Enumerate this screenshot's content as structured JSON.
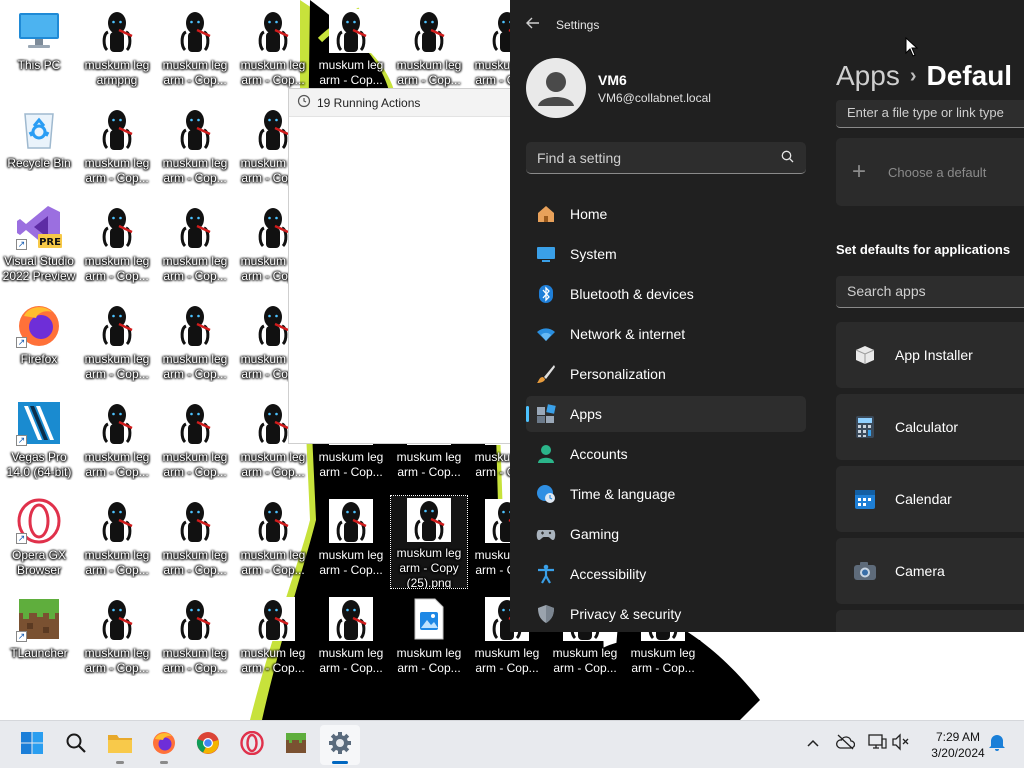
{
  "desktop": {
    "system_icons": [
      {
        "label": "This PC",
        "icon": "this-pc-icon"
      },
      {
        "label": "Recycle Bin",
        "icon": "recycle-bin-icon"
      },
      {
        "label": "Visual Studio 2022 Preview",
        "icon": "visual-studio-icon"
      },
      {
        "label": "Firefox",
        "icon": "firefox-icon"
      },
      {
        "label": "Vegas Pro 14.0 (64-bit)",
        "icon": "vegas-pro-icon"
      },
      {
        "label": "Opera GX Browser",
        "icon": "opera-gx-icon"
      },
      {
        "label": "TLauncher",
        "icon": "tlauncher-icon"
      }
    ],
    "file_labels": {
      "first": "muskum leg armpng",
      "copy": "muskum leg arm - Cop...",
      "selected": "muskum leg arm - Copy (25).png"
    }
  },
  "running_window": {
    "title": "19 Running Actions"
  },
  "settings": {
    "app_title": "Settings",
    "user": {
      "name": "VM6",
      "email": "VM6@collabnet.local"
    },
    "search_placeholder": "Find a setting",
    "nav": [
      {
        "label": "Home",
        "icon": "home-icon"
      },
      {
        "label": "System",
        "icon": "system-icon"
      },
      {
        "label": "Bluetooth & devices",
        "icon": "bluetooth-icon"
      },
      {
        "label": "Network & internet",
        "icon": "wifi-icon"
      },
      {
        "label": "Personalization",
        "icon": "brush-icon"
      },
      {
        "label": "Apps",
        "icon": "apps-icon",
        "active": true
      },
      {
        "label": "Accounts",
        "icon": "accounts-icon"
      },
      {
        "label": "Time & language",
        "icon": "globe-clock-icon"
      },
      {
        "label": "Gaming",
        "icon": "gamepad-icon"
      },
      {
        "label": "Accessibility",
        "icon": "accessibility-icon"
      },
      {
        "label": "Privacy & security",
        "icon": "shield-icon"
      }
    ],
    "content": {
      "breadcrumb_parent": "Apps",
      "breadcrumb_separator": "›",
      "breadcrumb_current": "Defaul",
      "filetype_placeholder": "Enter a file type or link type",
      "choose_default": "Choose a default",
      "section_title": "Set defaults for applications",
      "apps_search_placeholder": "Search apps",
      "apps": [
        {
          "label": "App Installer",
          "icon": "app-installer-icon"
        },
        {
          "label": "Calculator",
          "icon": "calculator-icon"
        },
        {
          "label": "Calendar",
          "icon": "calendar-icon"
        },
        {
          "label": "Camera",
          "icon": "camera-icon"
        }
      ]
    }
  },
  "taskbar": {
    "pinned": [
      {
        "name": "start-button",
        "icon": "windows-logo-icon"
      },
      {
        "name": "search-button",
        "icon": "search-icon"
      },
      {
        "name": "file-explorer-button",
        "icon": "folder-icon"
      },
      {
        "name": "firefox-taskbar-button",
        "icon": "firefox-icon"
      },
      {
        "name": "chrome-taskbar-button",
        "icon": "chrome-icon"
      },
      {
        "name": "opera-taskbar-button",
        "icon": "opera-icon"
      },
      {
        "name": "minecraft-taskbar-button",
        "icon": "minecraft-icon"
      },
      {
        "name": "settings-taskbar-button",
        "icon": "gear-icon",
        "active": true
      }
    ],
    "time": "7:29 AM",
    "date": "3/20/2024"
  },
  "colors": {
    "settings_bg": "#202020",
    "accent": "#4cc2ff",
    "taskbar_bg": "#e8eaee"
  }
}
